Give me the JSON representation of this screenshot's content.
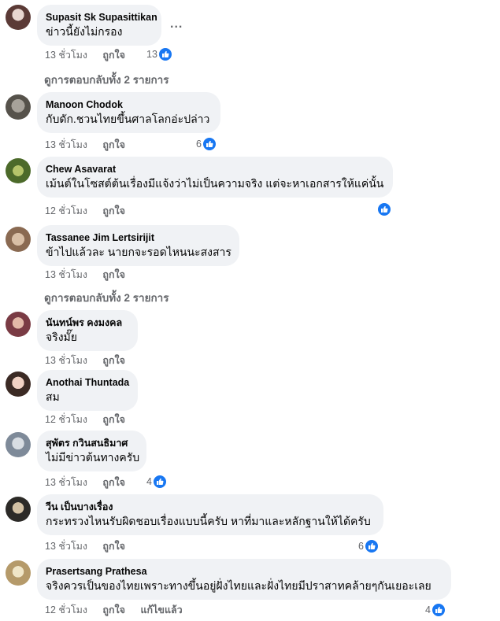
{
  "comments": [
    {
      "author": "Supasit Sk Supasittikan",
      "text": "ข่าวนี้ยังไม่กรอง",
      "time": "13 ชั่วโมง",
      "like": "ถูกใจ",
      "reactions": "13",
      "extra": ""
    },
    {
      "author": "Manoon Chodok",
      "text": "กับดัก.ชวนไทยขึ้นศาลโลกอ่ะปล่าว",
      "time": "13 ชั่วโมง",
      "like": "ถูกใจ",
      "reactions": "6",
      "extra": ""
    },
    {
      "author": "Chew Asavarat",
      "text": "เม้นต์ในโซสต์ต้นเรื่องมีแจ้งว่าไม่เป็นความจริง แต่จะหาเอกสารให้แค่นั้น",
      "time": "12 ชั่วโมง",
      "like": "ถูกใจ",
      "reactions": "",
      "extra": ""
    },
    {
      "author": "Tassanee Jim Lertsirijit",
      "text": "ข้าไปแล้วละ นายกจะรอดไหนนะสงสาร",
      "time": "13 ชั่วโมง",
      "like": "ถูกใจ",
      "reactions": "",
      "extra": ""
    },
    {
      "author": "นันทน์พร คงมงคล",
      "text": "จริงมั๊ย",
      "time": "13 ชั่วโมง",
      "like": "ถูกใจ",
      "reactions": "",
      "extra": ""
    },
    {
      "author": "Anothai Thuntada",
      "text": "สม",
      "time": "12 ชั่วโมง",
      "like": "ถูกใจ",
      "reactions": "",
      "extra": ""
    },
    {
      "author": "สุพัตร กวินสนธิมาศ",
      "text": "ไม่มีข่าวต้นทางครับ",
      "time": "13 ชั่วโมง",
      "like": "ถูกใจ",
      "reactions": "4",
      "extra": ""
    },
    {
      "author": "วีน เป็นบางเรื่อง",
      "text": "กระทรวงไหนรับผิดชอบเรื่องแบบนี้ครับ หาที่มาและหลักฐานให้ได้ครับ",
      "time": "13 ชั่วโมง",
      "like": "ถูกใจ",
      "reactions": "6",
      "extra": ""
    },
    {
      "author": "Prasertsang Prathesa",
      "text": "จริงควรเป็นของไทยเพราะทางขึ้นอยู่ฝั่งไทยและฝั่งไทยมีปราสาทคล้ายๆกันเยอะเลย",
      "time": "12 ชั่วโมง",
      "like": "ถูกใจ",
      "reactions": "4",
      "extra": "แก้ไขแล้ว"
    }
  ],
  "view_replies": "ดูการตอบกลับทั้ง 2 รายการ",
  "more_label": "...",
  "colors": {
    "bubble": "#f0f2f5",
    "meta": "#65676b",
    "like_blue": "#1877f2"
  }
}
